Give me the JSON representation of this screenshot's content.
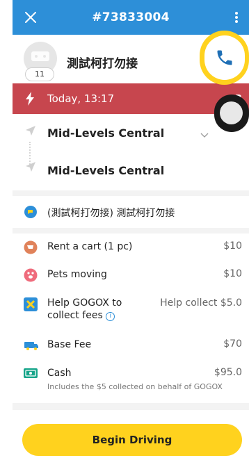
{
  "header": {
    "order_id": "#73833004"
  },
  "customer": {
    "name": "測試柯打勿接",
    "rating": "11"
  },
  "trip": {
    "time": "Today, 13:17",
    "passengers": "3"
  },
  "route": {
    "pickup": "Mid-Levels Central",
    "dropoff": "Mid-Levels Central"
  },
  "note": {
    "text": "(測試柯打勿接) 測試柯打勿接"
  },
  "fees": {
    "cart": {
      "label": "Rent a cart (1 pc)",
      "amount": "$10"
    },
    "pets": {
      "label": "Pets moving",
      "amount": "$10"
    },
    "collect": {
      "label_line1": "Help GOGOX to",
      "label_line2": "collect fees",
      "amount": "Help collect $5.0"
    },
    "base": {
      "label": "Base Fee",
      "amount": "$70"
    },
    "cash": {
      "label": "Cash",
      "amount": "$95.0",
      "sub": "Includes the $5 collected on behalf of GOGOX"
    }
  },
  "actions": {
    "begin": "Begin Driving"
  },
  "colors": {
    "header": "#2d8fd8",
    "timebar": "#c7464e",
    "accent": "#ffd21e"
  }
}
